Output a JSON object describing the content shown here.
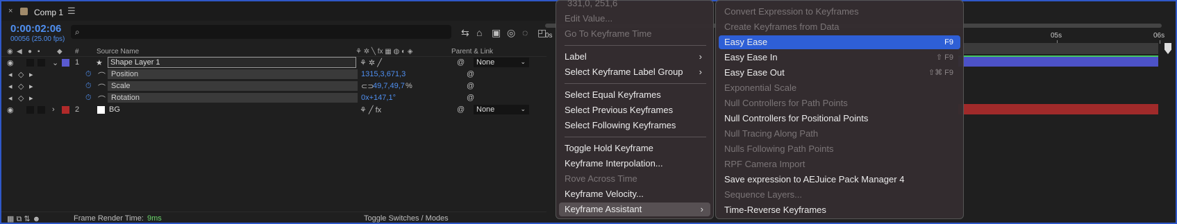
{
  "window": {
    "close": "×",
    "comp_tab": "Comp 1",
    "menu_glyph": "☰"
  },
  "comp": {
    "timecode": "0:00:02:06",
    "fps": "00056 (25.00 fps)",
    "search_placeholder": ""
  },
  "headers": {
    "number": "#",
    "source_name": "Source Name",
    "parent_link": "Parent & Link"
  },
  "layers": [
    {
      "index": "1",
      "name": "Shape Layer 1",
      "parent": "None",
      "color": "#5a5ad0"
    },
    {
      "index": "2",
      "name": "BG",
      "parent": "None",
      "color": "#b02a2a"
    }
  ],
  "properties": [
    {
      "name": "Position",
      "value": "1315,3,671,3"
    },
    {
      "name": "Scale",
      "value": "49,7,49,7",
      "unit": "%"
    },
    {
      "name": "Rotation",
      "value": "0x+147,1°"
    }
  ],
  "status": {
    "render_label": "Frame Render Time:",
    "render_value": "9ms",
    "toggle": "Toggle Switches / Modes"
  },
  "ruler": {
    "labels": [
      "0s",
      "05s",
      "06s"
    ]
  },
  "menu_left": {
    "items": [
      {
        "label": "331,0, 251,6",
        "enabled": false
      },
      {
        "label": "Edit Value...",
        "enabled": false
      },
      {
        "label": "Go To Keyframe Time",
        "enabled": false
      },
      {
        "label": "Label",
        "enabled": true,
        "submenu": true
      },
      {
        "label": "Select Keyframe Label Group",
        "enabled": true,
        "submenu": true
      },
      {
        "label": "Select Equal Keyframes",
        "enabled": true
      },
      {
        "label": "Select Previous Keyframes",
        "enabled": true
      },
      {
        "label": "Select Following Keyframes",
        "enabled": true
      },
      {
        "label": "Toggle Hold Keyframe",
        "enabled": true
      },
      {
        "label": "Keyframe Interpolation...",
        "enabled": true
      },
      {
        "label": "Rove Across Time",
        "enabled": false
      },
      {
        "label": "Keyframe Velocity...",
        "enabled": true
      },
      {
        "label": "Keyframe Assistant",
        "enabled": true,
        "submenu": true,
        "highlighted": true
      }
    ],
    "arrow": "›"
  },
  "menu_right": {
    "items": [
      {
        "label": "Convert Expression to Keyframes",
        "enabled": false
      },
      {
        "label": "Create Keyframes from Data",
        "enabled": false
      },
      {
        "label": "Easy Ease",
        "enabled": true,
        "shortcut": "F9",
        "highlighted": true
      },
      {
        "label": "Easy Ease In",
        "enabled": true,
        "shortcut": "⇧ F9"
      },
      {
        "label": "Easy Ease Out",
        "enabled": true,
        "shortcut": "⇧⌘ F9"
      },
      {
        "label": "Exponential Scale",
        "enabled": false
      },
      {
        "label": "Null Controllers for Path Points",
        "enabled": false
      },
      {
        "label": "Null Controllers for Positional Points",
        "enabled": true
      },
      {
        "label": "Null Tracing Along Path",
        "enabled": false
      },
      {
        "label": "Nulls Following Path Points",
        "enabled": false
      },
      {
        "label": "RPF Camera Import",
        "enabled": false
      },
      {
        "label": "Save expression to AEJuice Pack Manager 4",
        "enabled": true
      },
      {
        "label": "Sequence Layers...",
        "enabled": false
      },
      {
        "label": "Time-Reverse Keyframes",
        "enabled": true
      }
    ]
  },
  "colors": {
    "accent_blue": "#2e5fd6",
    "timecode": "#4f8ff0",
    "shape_bar": "#4c52c8",
    "bg_bar": "#a02a2a",
    "render_value": "#6bd66b"
  }
}
